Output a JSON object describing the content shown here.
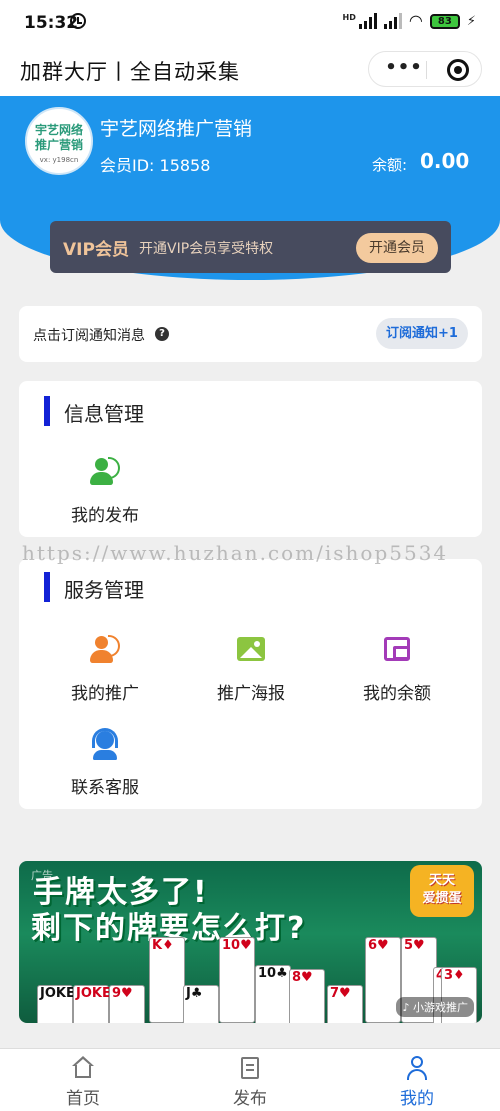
{
  "status_bar": {
    "time": "15:32",
    "network": "HD",
    "battery": "83"
  },
  "title_bar": {
    "title": "加群大厅丨全自动采集",
    "menu_dots": "•••"
  },
  "profile": {
    "avatar_text_line1": "宇艺网络",
    "avatar_text_line2": "推广营销",
    "avatar_text_line3": "vx: y198cn",
    "shop_name": "宇艺网络推广营销",
    "member_id": "会员ID: 15858",
    "balance_label": "余额:",
    "balance_value": "0.00"
  },
  "vip": {
    "title": "VIP会员",
    "desc": "开通VIP会员享受特权",
    "button": "开通会员"
  },
  "subscribe": {
    "text": "点击订阅通知消息",
    "help": "?",
    "button": "订阅通知+1"
  },
  "info_section": {
    "title": "信息管理",
    "items": [
      {
        "label": "我的发布",
        "icon": "user-publish-icon",
        "color": "#3cb043"
      }
    ]
  },
  "service_section": {
    "title": "服务管理",
    "items": [
      {
        "label": "我的推广",
        "icon": "user-promo-icon",
        "color": "#f0822e"
      },
      {
        "label": "推广海报",
        "icon": "poster-image-icon",
        "color": "#8cc540"
      },
      {
        "label": "我的余额",
        "icon": "wallet-icon",
        "color": "#a33bb8"
      },
      {
        "label": "联系客服",
        "icon": "customer-service-icon",
        "color": "#2a7ee0"
      }
    ]
  },
  "watermark": "https://www.huzhan.com/ishop5534",
  "ad": {
    "tag": "广告",
    "line1": "手牌太多了!",
    "line2": "剩下的牌要怎么打?",
    "logo_line1": "天天",
    "logo_line2": "爱掼蛋",
    "source": "♪ 小游戏推广",
    "cards": [
      "JOKER",
      "JOKER",
      "9♥",
      "K♦",
      "J♣",
      "10♥",
      "10♣",
      "8♥",
      "7♥",
      "6♥",
      "5♥",
      "4♦",
      "3♦"
    ]
  },
  "tabbar": {
    "tabs": [
      {
        "label": "首页",
        "icon": "home-icon"
      },
      {
        "label": "发布",
        "icon": "publish-icon"
      },
      {
        "label": "我的",
        "icon": "profile-icon"
      }
    ],
    "active_color": "#1e6cd9"
  }
}
